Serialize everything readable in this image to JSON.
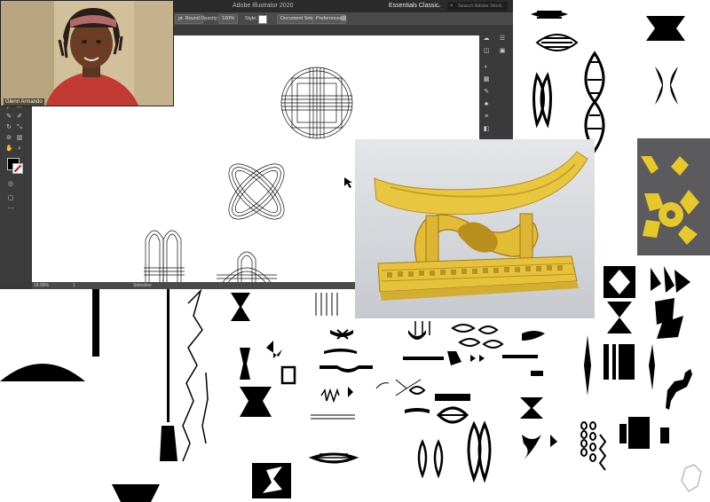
{
  "app": {
    "window_title": "Adobe Illustrator 2020",
    "workspace": "Essentials Classic",
    "search_placeholder": "Search Adobe Stock"
  },
  "controlbar": {
    "brush_label": "pt. Round",
    "opacity_label": "Opacity:",
    "opacity_value": "100%",
    "style_label": "Style:",
    "document_setup": "Document Setup",
    "preferences": "Preferences"
  },
  "statusbar": {
    "zoom": "18.09%",
    "page": "1",
    "tool": "Selection"
  },
  "webcam": {
    "participant_name": "Glenn Armando"
  },
  "colors": {
    "stool_yellow": "#e9c640",
    "swatch_yellow": "#e7c82a",
    "panel_gray": "#5b5b5d",
    "ui_dark": "#3a3a3a"
  },
  "icons": [
    "apple-icon",
    "home-icon",
    "search-icon",
    "selection-tool-icon",
    "direct-selection-tool-icon",
    "pen-tool-icon",
    "type-tool-icon",
    "fill-stroke-icon",
    "layers-icon",
    "color-icon",
    "swatches-icon"
  ]
}
